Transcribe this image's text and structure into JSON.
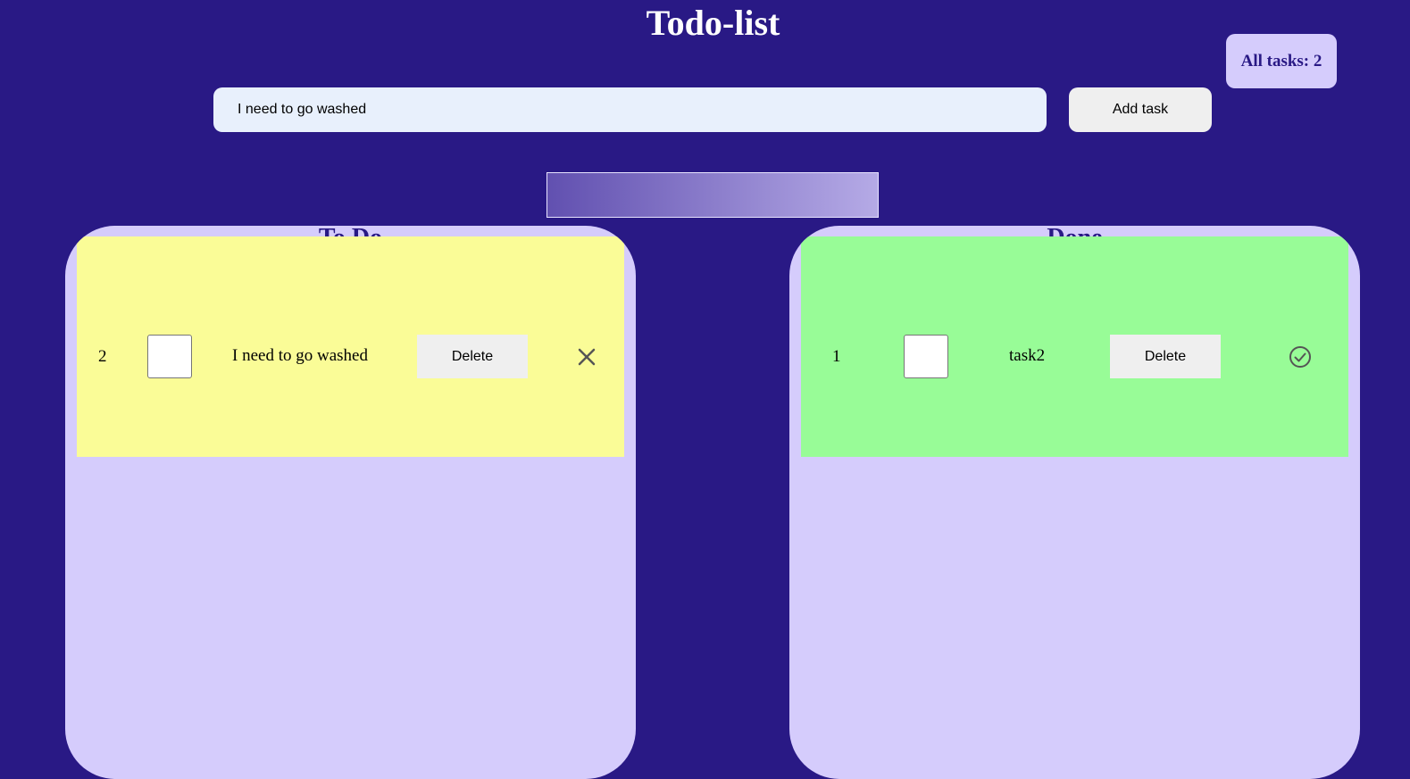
{
  "app": {
    "title": "Todo-list",
    "all_tasks_label": "All tasks: 2"
  },
  "new_task": {
    "input_value": "I need to go washed",
    "add_button_label": "Add task"
  },
  "columns": {
    "todo": {
      "title": "To Do",
      "tasks": [
        {
          "number": "2",
          "checked": false,
          "text": "I need to go washed",
          "delete_label": "Delete",
          "status_icon": "close-icon"
        }
      ]
    },
    "done": {
      "title": "Done",
      "tasks": [
        {
          "number": "1",
          "checked": false,
          "text": "task2",
          "delete_label": "Delete",
          "status_icon": "check-circle-icon"
        }
      ]
    }
  },
  "colors": {
    "background": "#291985",
    "column_background": "#d5ccfc",
    "todo_task_background": "#fafc97",
    "done_task_background": "#98fc97"
  }
}
